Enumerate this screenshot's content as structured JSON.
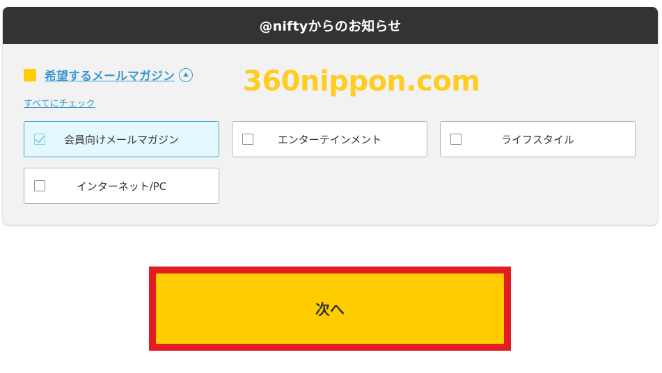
{
  "panel": {
    "title": "@niftyからのお知らせ"
  },
  "section": {
    "title": "希望するメールマガジン",
    "check_all": "すべてにチェック"
  },
  "watermark": "360nippon.com",
  "options": [
    {
      "label": "会員向けメールマガジン",
      "checked": true
    },
    {
      "label": "エンターテインメント",
      "checked": false
    },
    {
      "label": "ライフスタイル",
      "checked": false
    },
    {
      "label": "インターネット/PC",
      "checked": false
    }
  ],
  "next_button": {
    "label": "次へ"
  },
  "colors": {
    "header_bg": "#333333",
    "accent_yellow": "#ffcc00",
    "link_blue": "#3a9ad0",
    "highlight_red": "#e31b23",
    "checked_bg": "#e3f9fd"
  }
}
